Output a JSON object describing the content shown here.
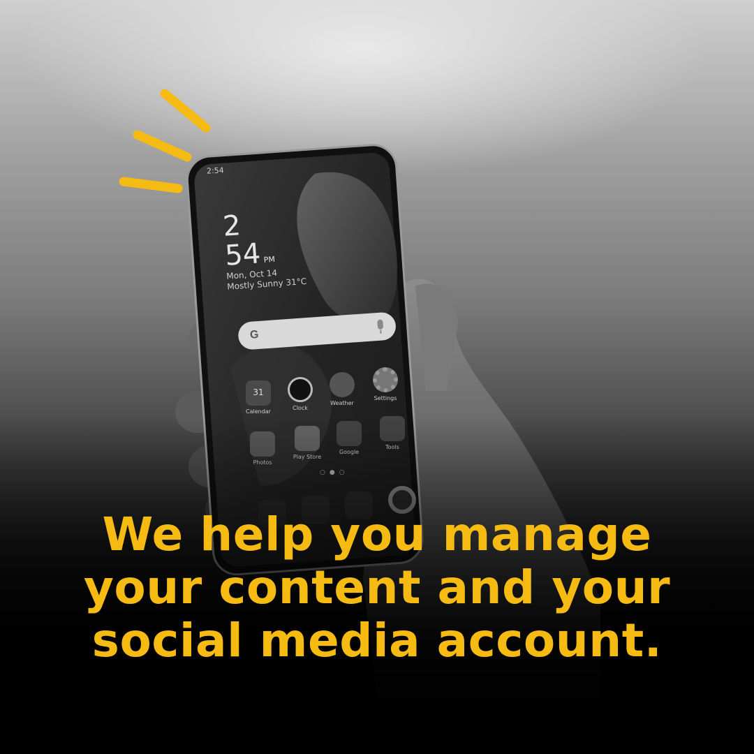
{
  "colors": {
    "accent": "#f5bb12",
    "background_top": "#cfcfcf",
    "background_bottom": "#000000"
  },
  "phone_screen": {
    "status_time": "2:54",
    "clock_hour": "2",
    "clock_minutes": "54",
    "clock_ampm": "PM",
    "date": "Mon, Oct 14",
    "weather": "Mostly Sunny 31°C",
    "search_logo": "G",
    "apps_row1": [
      "Calendar",
      "Clock",
      "Weather",
      "Settings"
    ],
    "calendar_day": "31",
    "apps_row2": [
      "Photos",
      "Play Store",
      "Google",
      "Tools"
    ]
  },
  "icons": {
    "accent_lines": "attention-burst-icon",
    "search": "google-g-icon",
    "mic": "microphone-icon"
  },
  "headline": {
    "line1": "We help you manage",
    "line2": "your content and your",
    "line3": "social media account."
  }
}
